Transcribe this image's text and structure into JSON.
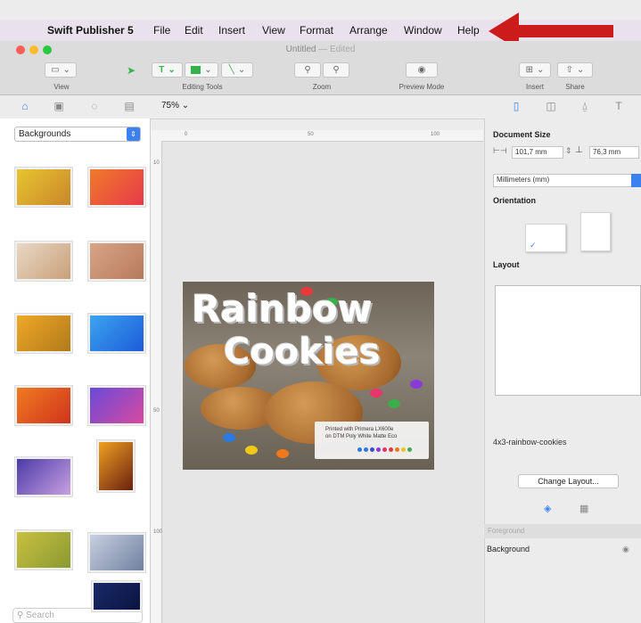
{
  "menubar": {
    "apple": "",
    "app_name": "Swift Publisher 5",
    "items": [
      "File",
      "Edit",
      "Insert",
      "View",
      "Format",
      "Arrange",
      "Window",
      "Help"
    ]
  },
  "window": {
    "title": "Untitled",
    "title_suffix": "— Edited"
  },
  "toolbar": {
    "view_label": "View",
    "editing_tools_label": "Editing Tools",
    "zoom_label": "Zoom",
    "preview_label": "Preview Mode",
    "insert_label": "Insert",
    "share_label": "Share"
  },
  "subbar": {
    "zoom_value": "75%"
  },
  "library": {
    "category": "Backgrounds",
    "search_placeholder": "Search",
    "thumbnails": [
      {
        "name": "yellow-paint",
        "color_a": "#e8c430",
        "color_b": "#c8872a"
      },
      {
        "name": "orange-stripes",
        "color_a": "#f07a2a",
        "color_b": "#e63a4a"
      },
      {
        "name": "speckled-beige",
        "color_a": "#e8d8c4",
        "color_b": "#c9a07a"
      },
      {
        "name": "wood-grain",
        "color_a": "#d8a486",
        "color_b": "#b67a5c"
      },
      {
        "name": "yellow-floral",
        "color_a": "#f0a828",
        "color_b": "#b07a1a"
      },
      {
        "name": "blue-abstract",
        "color_a": "#3ca4f0",
        "color_b": "#1c5cd8"
      },
      {
        "name": "orange-red",
        "color_a": "#f07a22",
        "color_b": "#d0341c"
      },
      {
        "name": "purple-blue",
        "color_a": "#6a4ad8",
        "color_b": "#d84aa0"
      },
      {
        "name": "purple-bokeh",
        "color_a": "#4a3aa8",
        "color_b": "#c8a0e0"
      },
      {
        "name": "fire-amber",
        "color_a": "#f0a020",
        "color_b": "#6a2010"
      },
      {
        "name": "golden-green",
        "color_a": "#c8c040",
        "color_b": "#8a9a30"
      },
      {
        "name": "silver-blue",
        "color_a": "#c8d0e0",
        "color_b": "#7080a0"
      },
      {
        "name": "navy-texture",
        "color_a": "#1a2a6a",
        "color_b": "#0a1440"
      }
    ]
  },
  "rulers": {
    "h_ticks": [
      "0",
      "50",
      "100"
    ],
    "v_ticks": [
      "10",
      "50",
      "100"
    ]
  },
  "card": {
    "title_line1": "Rainbow",
    "title_line2": "Cookies",
    "stamp_line1": "Printed with Primera LX600e",
    "stamp_line2": "on DTM Poly White Matte Eco"
  },
  "inspector": {
    "document_size_label": "Document Size",
    "width_value": "101,7 mm",
    "height_value": "76,3 mm",
    "units_value": "Millimeters (mm)",
    "orientation_label": "Orientation",
    "layout_label": "Layout",
    "layout_name": "4x3-rainbow-cookies",
    "change_layout_button": "Change Layout...",
    "layers_header": "Foreground",
    "layer_background": "Background"
  },
  "colors": {
    "annotation_arrow": "#cc1b1b",
    "accent_blue": "#3b82f0",
    "tool_green": "#35b24a"
  }
}
